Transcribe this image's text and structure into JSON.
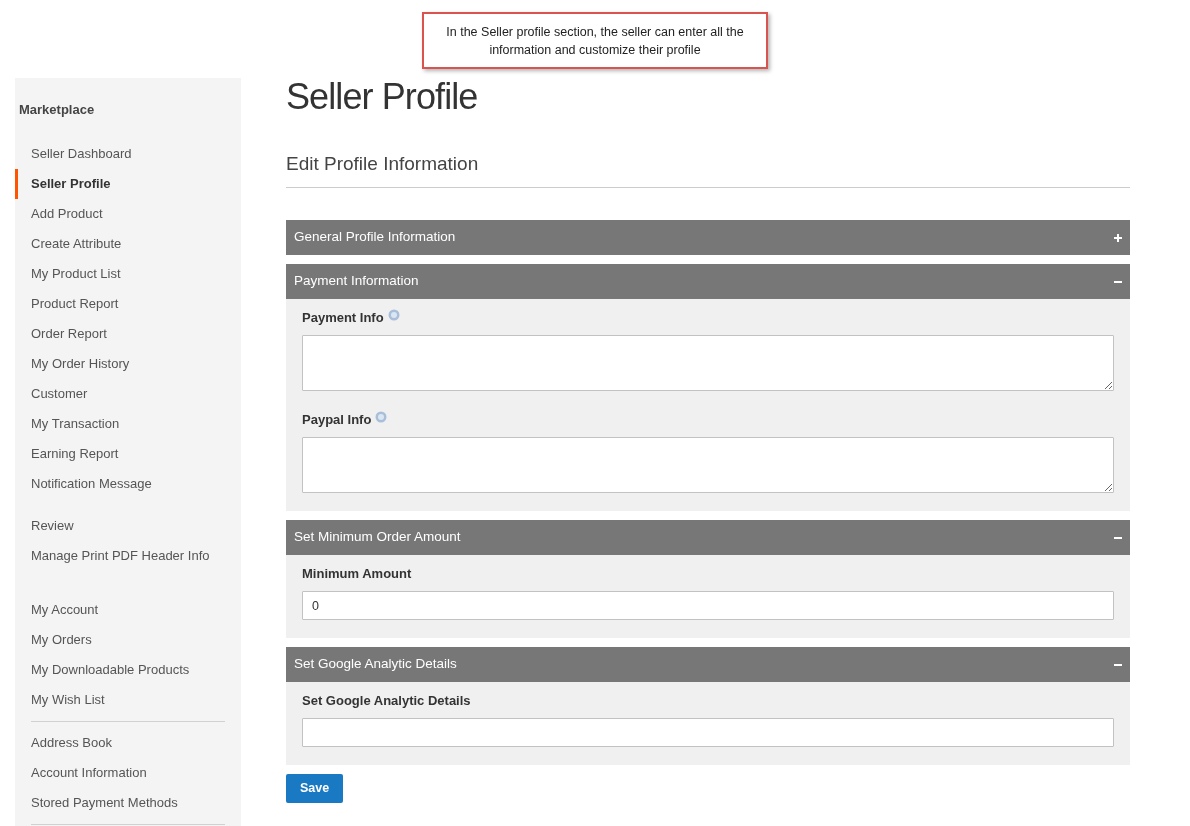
{
  "callout": {
    "text": "In the Seller profile section, the seller can enter all the information and customize their profile"
  },
  "sidebar": {
    "title": "Marketplace",
    "groups": [
      {
        "kind": "spaced",
        "items": [
          {
            "label": "Seller Dashboard",
            "selected": false
          },
          {
            "label": "Seller Profile",
            "selected": true
          },
          {
            "label": "Add Product",
            "selected": false
          },
          {
            "label": "Create Attribute",
            "selected": false
          },
          {
            "label": "My Product List",
            "selected": false
          },
          {
            "label": "Product Report",
            "selected": false
          },
          {
            "label": "Order Report",
            "selected": false
          },
          {
            "label": "My Order History",
            "selected": false
          },
          {
            "label": "Customer",
            "selected": false
          },
          {
            "label": "My Transaction",
            "selected": false
          },
          {
            "label": "Earning Report",
            "selected": false
          },
          {
            "label": "Notification Message",
            "selected": false
          }
        ]
      },
      {
        "kind": "wide",
        "items": [
          {
            "label": "Review",
            "selected": false
          },
          {
            "label": "Manage Print PDF Header Info",
            "selected": false
          }
        ]
      },
      {
        "kind": "ruled",
        "items": [
          {
            "label": "My Account",
            "selected": false
          },
          {
            "label": "My Orders",
            "selected": false
          },
          {
            "label": "My Downloadable Products",
            "selected": false
          },
          {
            "label": "My Wish List",
            "selected": false
          }
        ]
      },
      {
        "kind": "ruled",
        "items": [
          {
            "label": "Address Book",
            "selected": false
          },
          {
            "label": "Account Information",
            "selected": false
          },
          {
            "label": "Stored Payment Methods",
            "selected": false
          }
        ]
      }
    ]
  },
  "page": {
    "title": "Seller Profile",
    "subtitle": "Edit Profile Information"
  },
  "sections": [
    {
      "title": "General Profile Information",
      "expanded": false
    },
    {
      "title": "Payment Information",
      "expanded": true,
      "fields": [
        {
          "label": "Payment Info",
          "kind": "textarea",
          "help": true
        },
        {
          "label": "Paypal Info",
          "kind": "textarea",
          "help": true
        }
      ]
    },
    {
      "title": "Set Minimum Order Amount",
      "expanded": true,
      "fields": [
        {
          "label": "Minimum Amount",
          "kind": "input",
          "help": false,
          "value": "0"
        }
      ]
    },
    {
      "title": "Set Google Analytic Details",
      "expanded": true,
      "fields": [
        {
          "label": "Set Google Analytic Details",
          "kind": "input",
          "help": false
        }
      ]
    }
  ],
  "save_button": "Save"
}
